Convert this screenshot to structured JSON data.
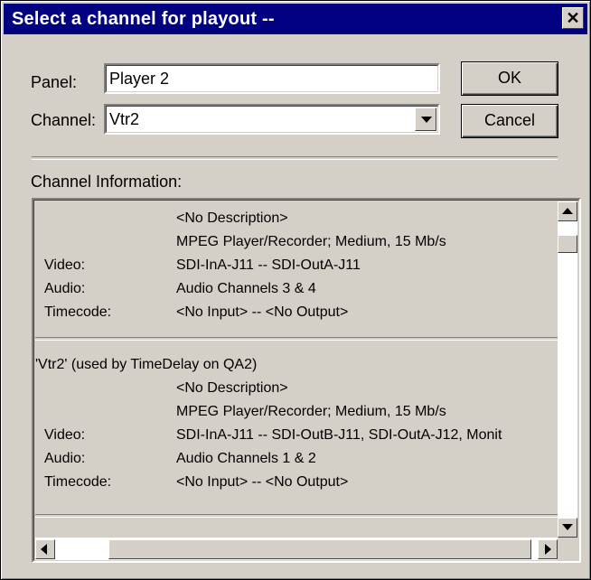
{
  "dialog": {
    "title": "Select a channel for playout --",
    "close_glyph": "✕"
  },
  "form": {
    "panel_label": "Panel:",
    "panel_value": "Player 2",
    "channel_label": "Channel:",
    "channel_value": "Vtr2"
  },
  "buttons": {
    "ok": "OK",
    "cancel": "Cancel"
  },
  "info": {
    "heading": "Channel Information:",
    "entries": [
      {
        "header": "",
        "description": "<No Description>",
        "type": "MPEG Player/Recorder; Medium, 15 Mb/s",
        "video_label": "Video:",
        "video": "SDI-InA-J11 -- SDI-OutA-J11",
        "audio_label": "Audio:",
        "audio": "Audio Channels 3 & 4",
        "timecode_label": "Timecode:",
        "timecode": "<No Input> -- <No Output>"
      },
      {
        "header": "'Vtr2' (used by TimeDelay on QA2)",
        "description": "<No Description>",
        "type": "MPEG Player/Recorder; Medium, 15 Mb/s",
        "video_label": "Video:",
        "video": "SDI-InA-J11 -- SDI-OutB-J11, SDI-OutA-J12, Monit",
        "audio_label": "Audio:",
        "audio": "Audio Channels 1 & 2",
        "timecode_label": "Timecode:",
        "timecode": "<No Input> -- <No Output>"
      }
    ]
  },
  "scroll": {
    "vertical_position": 0.05,
    "horizontal_position": 0.9
  },
  "colors": {
    "titlebar": "#000080",
    "face": "#d4d0c8"
  }
}
